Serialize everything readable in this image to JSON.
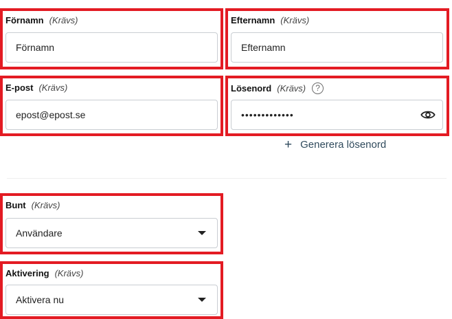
{
  "form": {
    "firstname": {
      "label": "Förnamn",
      "required": "(Krävs)",
      "value": "Förnamn"
    },
    "lastname": {
      "label": "Efternamn",
      "required": "(Krävs)",
      "value": "Efternamn"
    },
    "email": {
      "label": "E-post",
      "required": "(Krävs)",
      "value": "epost@epost.se"
    },
    "password": {
      "label": "Lösenord",
      "required": "(Krävs)",
      "help_icon_glyph": "?",
      "masked_value": "•••••••••••••",
      "show_icon": "eye-icon"
    },
    "generate": {
      "icon": "plus-icon",
      "label": "Generera lösenord"
    },
    "bundle": {
      "label": "Bunt",
      "required": "(Krävs)",
      "value": "Användare"
    },
    "activation": {
      "label": "Aktivering",
      "required": "(Krävs)",
      "value": "Aktivera nu"
    }
  },
  "colors": {
    "highlight": "#e31b23",
    "input_border": "#c9cdd2",
    "link": "#2f4a5c"
  }
}
